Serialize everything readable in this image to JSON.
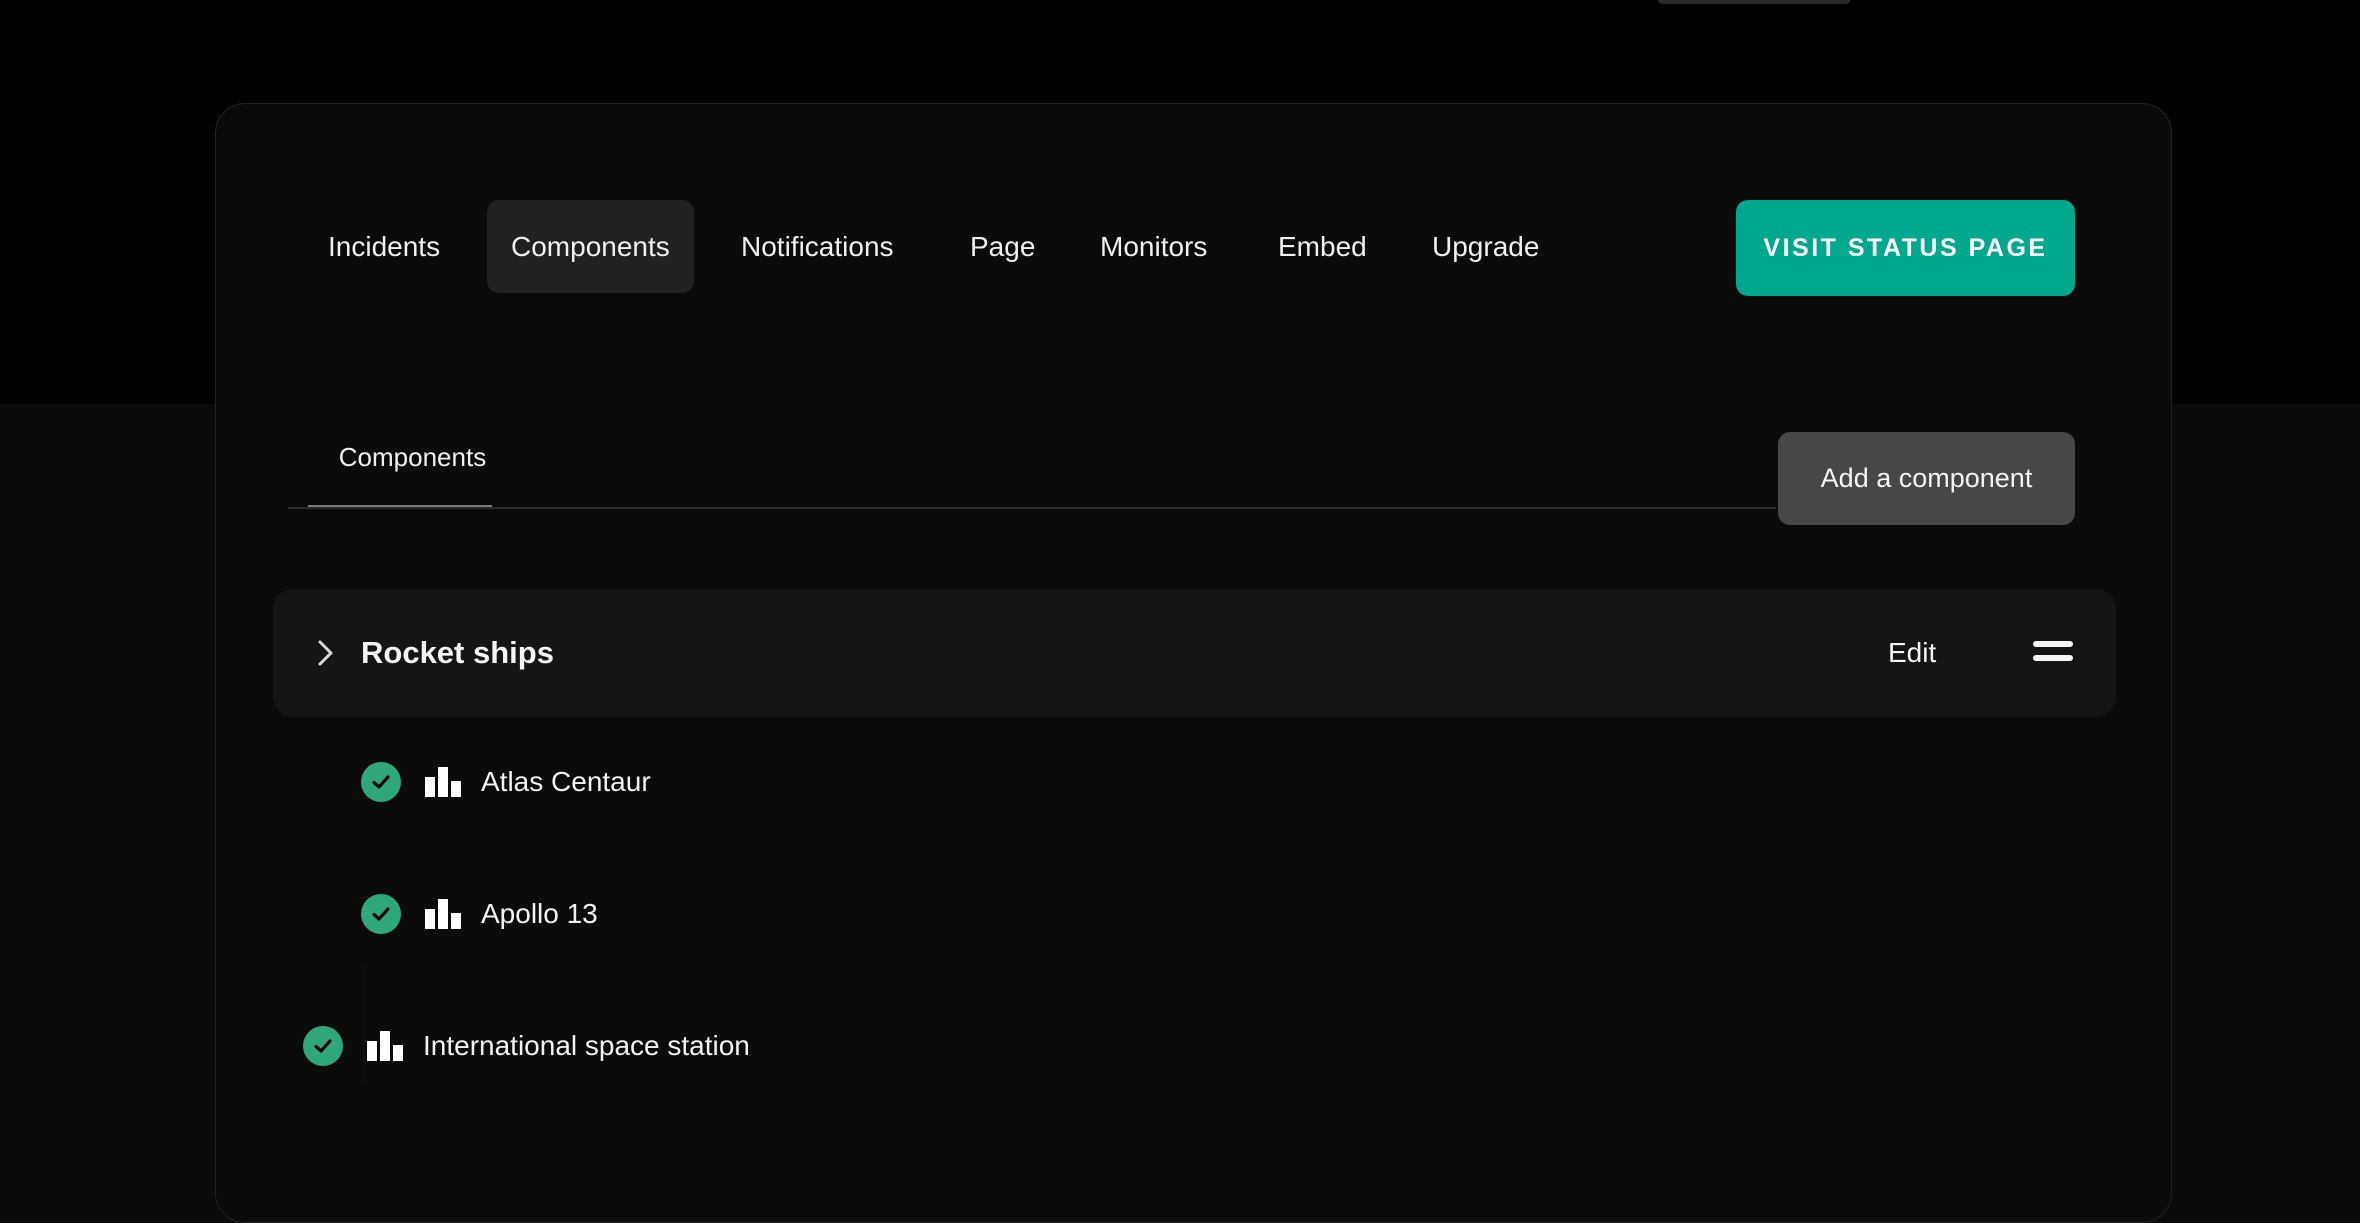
{
  "nav": {
    "items": [
      "Incidents",
      "Components",
      "Notifications",
      "Page",
      "Monitors",
      "Embed",
      "Upgrade"
    ],
    "active": "Components",
    "visit_button": "VISIT STATUS PAGE"
  },
  "subtabs": {
    "components": "Components"
  },
  "add_button": "Add a component",
  "group": {
    "title": "Rocket ships",
    "edit": "Edit",
    "components": [
      {
        "name": "Atlas Centaur",
        "status": "operational"
      },
      {
        "name": "Apollo 13",
        "status": "operational"
      }
    ]
  },
  "dragged_component": {
    "name": "International space station",
    "status": "operational"
  },
  "icons": {
    "status": "check-circle-icon",
    "component": "bar-chart-icon",
    "expand": "chevron-right-icon",
    "reorder": "drag-handle-icon"
  },
  "colors": {
    "accent": "#00a88c",
    "status_ok": "#2ea87a",
    "top_band": "#000000",
    "background": "#0b0b0b",
    "panel_border": "#232323",
    "row_background": "#151515",
    "button_secondary": "#474747"
  }
}
